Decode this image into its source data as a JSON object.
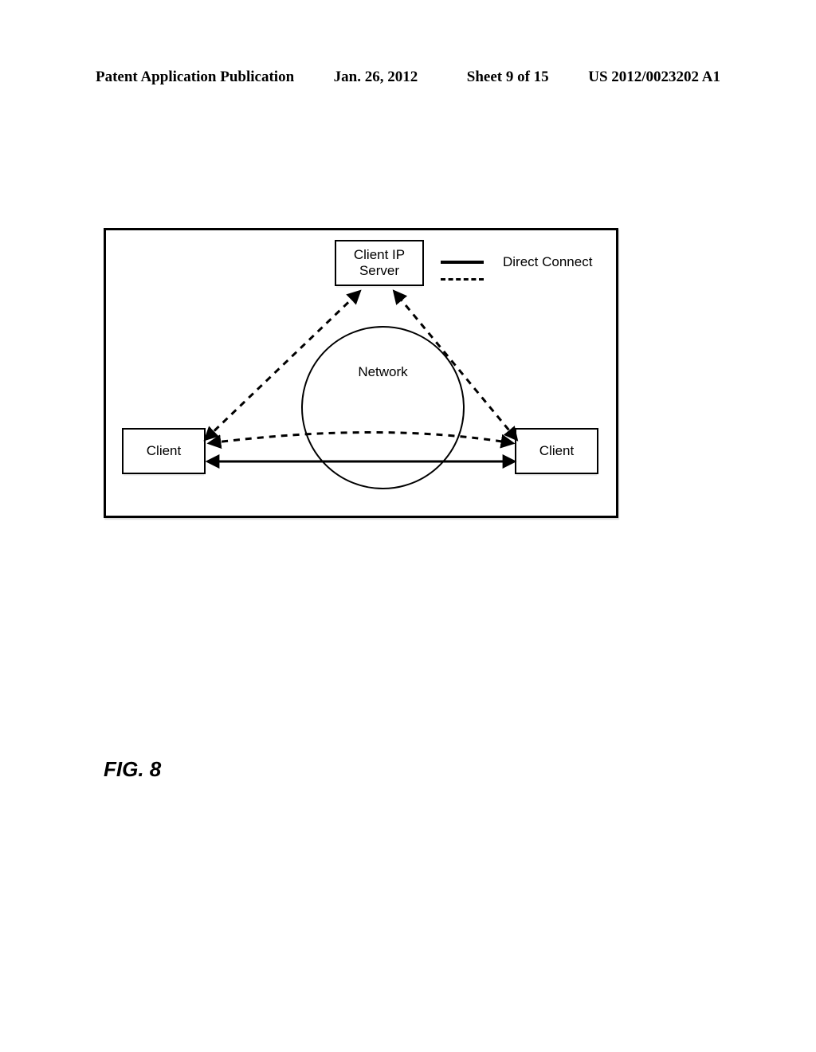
{
  "header": {
    "left": "Patent Application Publication",
    "date": "Jan. 26, 2012",
    "sheet": "Sheet 9 of 15",
    "pubno": "US 2012/0023202 A1"
  },
  "diagram": {
    "server": "Client IP\nServer",
    "network": "Network",
    "client_left": "Client",
    "client_right": "Client",
    "legend": {
      "direct": "Direct Connect",
      "other": ""
    }
  },
  "caption": "FIG. 8"
}
